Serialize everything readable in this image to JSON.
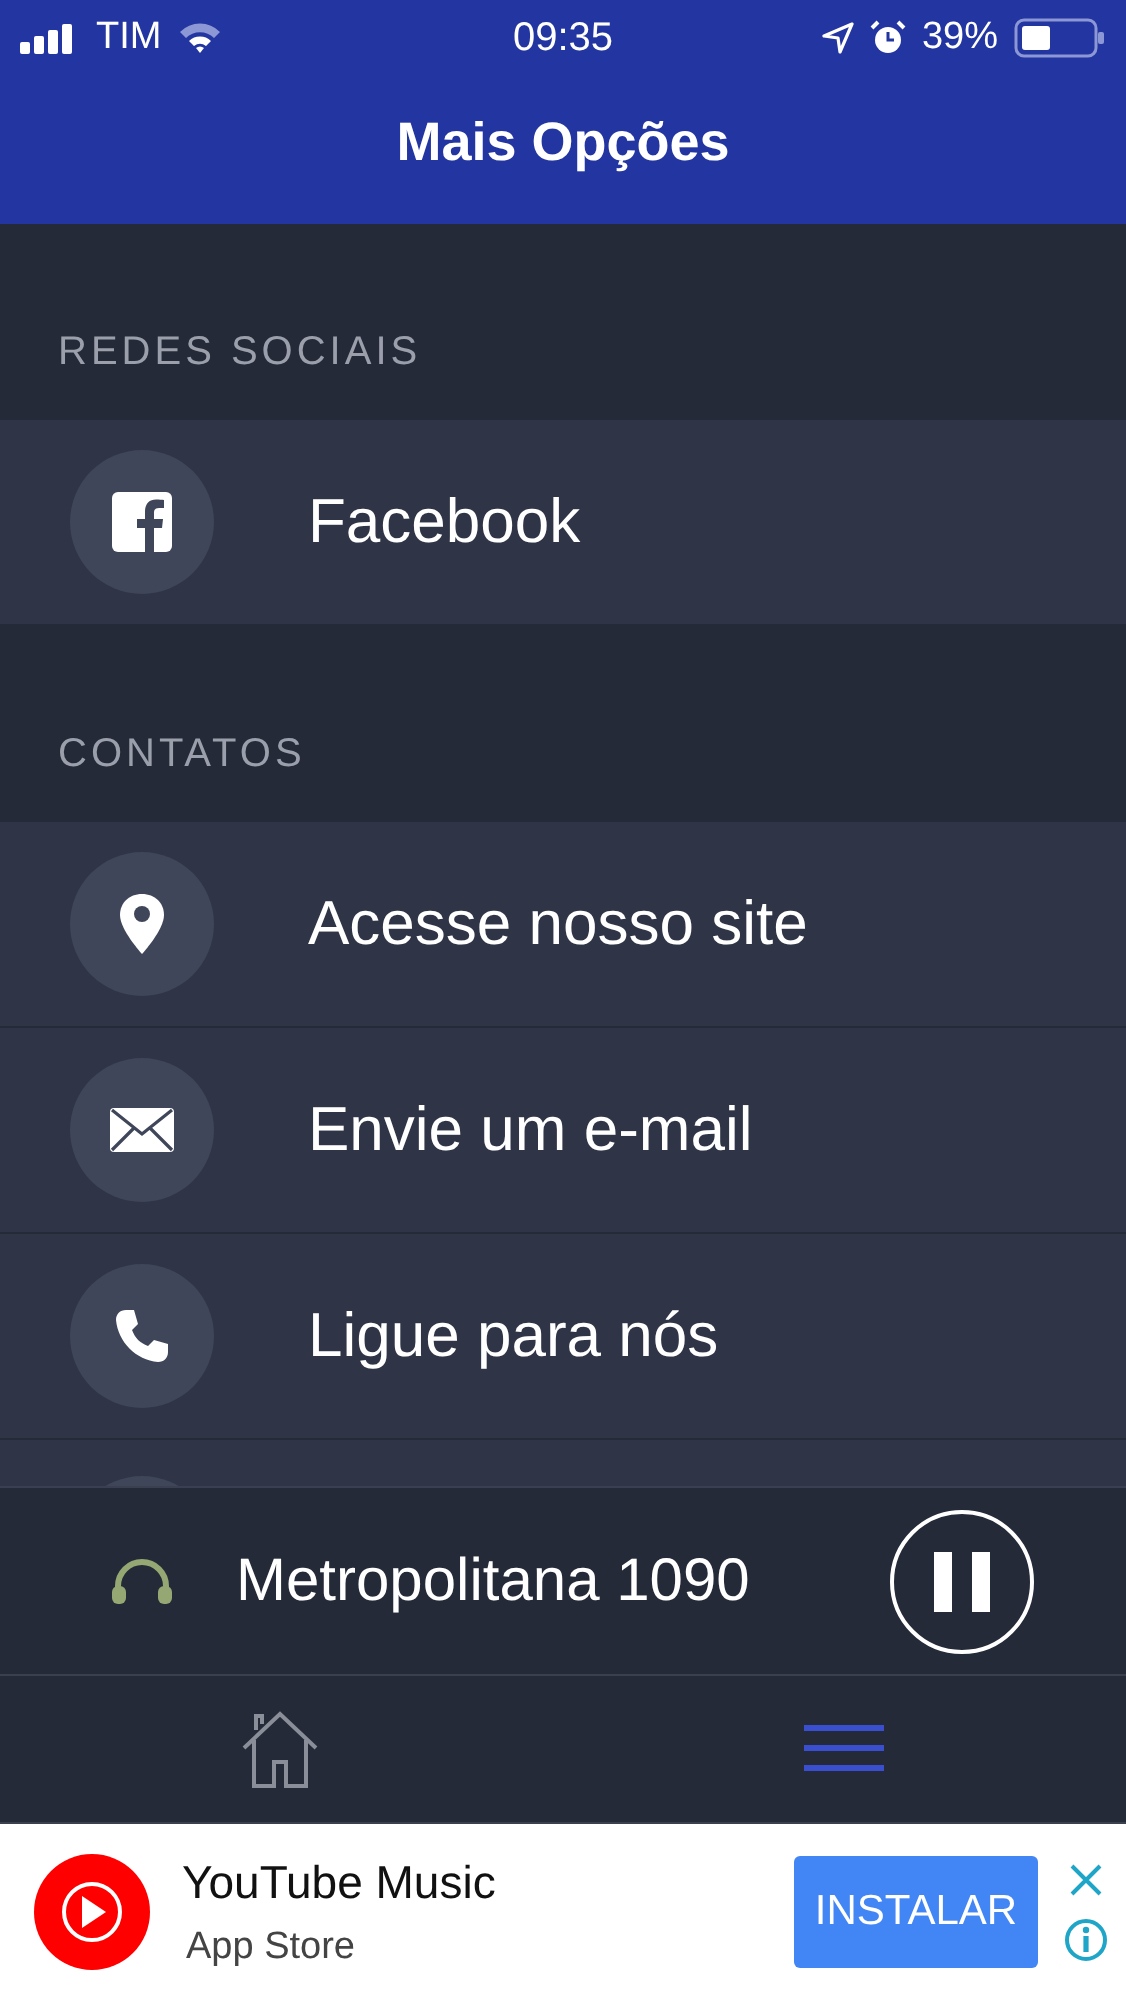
{
  "status_bar": {
    "carrier": "TIM",
    "time": "09:35",
    "battery": "39%"
  },
  "header": {
    "title": "Mais Opções"
  },
  "sections": [
    {
      "title": "REDES SOCIAIS",
      "items": [
        {
          "kind": "facebook",
          "label": "Facebook"
        }
      ]
    },
    {
      "title": "CONTATOS",
      "items": [
        {
          "kind": "pin",
          "label": "Acesse nosso site"
        },
        {
          "kind": "mail",
          "label": "Envie um e-mail"
        },
        {
          "kind": "phone",
          "label": "Ligue para nós"
        }
      ]
    }
  ],
  "player": {
    "station": "Metropolitana 1090",
    "playing": true
  },
  "tabs": [
    {
      "kind": "home",
      "selected": false
    },
    {
      "kind": "menu",
      "selected": true
    }
  ],
  "ad": {
    "title": "YouTube Music",
    "subtitle": "App Store",
    "button": "INSTALAR"
  }
}
